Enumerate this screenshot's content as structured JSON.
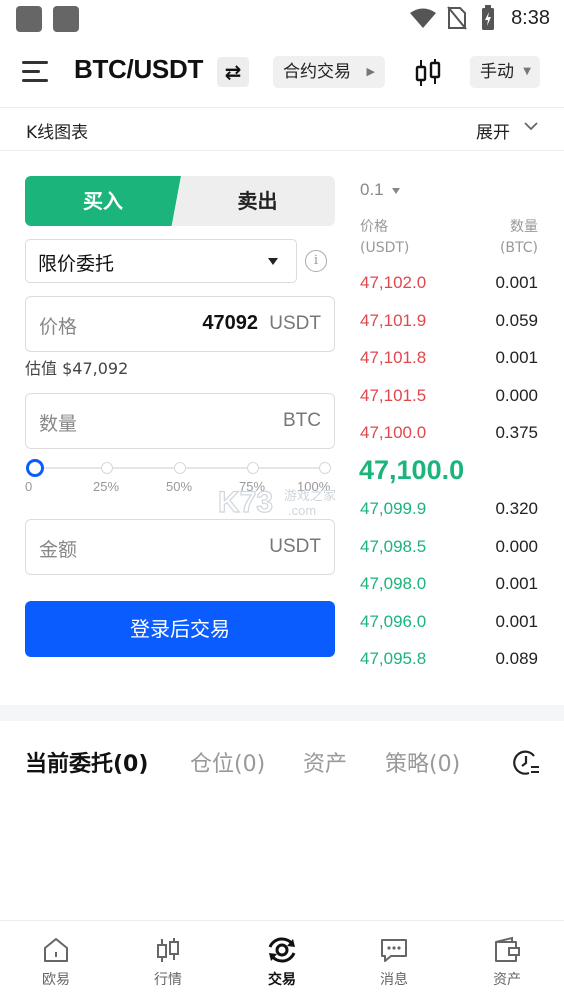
{
  "status_bar": {
    "time": "8:38"
  },
  "header": {
    "pair": "BTC/USDT",
    "swap_symbol": "⇄",
    "contract_label": "合约交易",
    "mode_label": "手动"
  },
  "kline": {
    "label": "K线图表",
    "expand_label": "展开"
  },
  "trade": {
    "buy_label": "买入",
    "sell_label": "卖出",
    "order_type": "限价委托",
    "price_placeholder": "价格",
    "price_value": "47092",
    "price_unit": "USDT",
    "estimate": "估值 $47,092",
    "amount_placeholder": "数量",
    "amount_unit": "BTC",
    "slider": {
      "value_percent": 0,
      "labels": [
        "0",
        "25%",
        "50%",
        "75%",
        "100%"
      ]
    },
    "total_placeholder": "金额",
    "total_unit": "USDT",
    "login_button": "登录后交易"
  },
  "order_book": {
    "step": "0.1",
    "price_header": "价格",
    "price_header_unit": "(USDT)",
    "qty_header": "数量",
    "qty_header_unit": "(BTC)",
    "asks": [
      {
        "price": "47,102.0",
        "qty": "0.001"
      },
      {
        "price": "47,101.9",
        "qty": "0.059"
      },
      {
        "price": "47,101.8",
        "qty": "0.001"
      },
      {
        "price": "47,101.5",
        "qty": "0.000"
      },
      {
        "price": "47,100.0",
        "qty": "0.375"
      }
    ],
    "last_price": "47,100.0",
    "bids": [
      {
        "price": "47,099.9",
        "qty": "0.320"
      },
      {
        "price": "47,098.5",
        "qty": "0.000"
      },
      {
        "price": "47,098.0",
        "qty": "0.001"
      },
      {
        "price": "47,096.0",
        "qty": "0.001"
      },
      {
        "price": "47,095.8",
        "qty": "0.089"
      }
    ]
  },
  "watermark": {
    "text": "K73",
    "sub": "游戏之家",
    "domain": ".com"
  },
  "tabs": [
    {
      "label": "当前委托(0)",
      "active": true
    },
    {
      "label": "仓位(0)",
      "active": false
    },
    {
      "label": "资产",
      "active": false
    },
    {
      "label": "策略(0)",
      "active": false
    }
  ],
  "bottom_nav": [
    {
      "label": "欧易",
      "icon": "home-icon",
      "active": false
    },
    {
      "label": "行情",
      "icon": "candlestick-icon",
      "active": false
    },
    {
      "label": "交易",
      "icon": "trade-icon",
      "active": true
    },
    {
      "label": "消息",
      "icon": "message-icon",
      "active": false
    },
    {
      "label": "资产",
      "icon": "wallet-icon",
      "active": false
    }
  ],
  "colors": {
    "buy_green": "#1bb47b",
    "sell_red": "#e1474f",
    "primary_blue": "#0b5cff"
  }
}
